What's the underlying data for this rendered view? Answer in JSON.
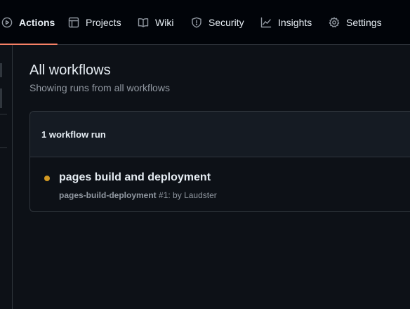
{
  "repo_nav": {
    "items": [
      {
        "label": "Actions",
        "icon": "play-icon",
        "active": true
      },
      {
        "label": "Projects",
        "icon": "table-icon"
      },
      {
        "label": "Wiki",
        "icon": "book-icon"
      },
      {
        "label": "Security",
        "icon": "shield-icon"
      },
      {
        "label": "Insights",
        "icon": "graph-icon"
      },
      {
        "label": "Settings",
        "icon": "gear-icon"
      }
    ],
    "active_color": "#f78166"
  },
  "main": {
    "title": "All workflows",
    "subtitle": "Showing runs from all workflows",
    "runs": {
      "count_label": "1 workflow run",
      "items": [
        {
          "title": "pages build and deployment",
          "workflow": "pages-build-deployment",
          "run_number": "#1",
          "by_text": ": by Laudster",
          "status": "in-progress",
          "status_color": "#d29922"
        }
      ]
    }
  }
}
